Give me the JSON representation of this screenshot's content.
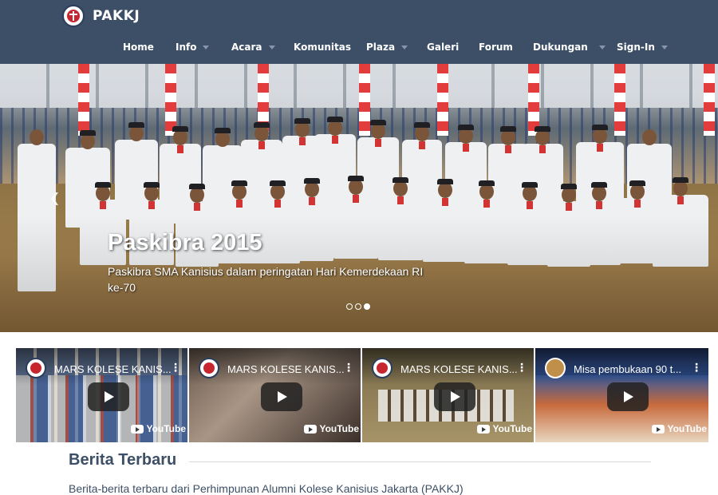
{
  "brand": {
    "name": "PAKKJ"
  },
  "nav": [
    {
      "label": "Home",
      "dropdown": false
    },
    {
      "label": "Info",
      "dropdown": true
    },
    {
      "label": "Acara",
      "dropdown": true
    },
    {
      "label": "Komunitas",
      "dropdown": false
    },
    {
      "label": "Plaza",
      "dropdown": true
    },
    {
      "label": "Galeri",
      "dropdown": false
    },
    {
      "label": "Forum",
      "dropdown": false
    },
    {
      "label": "Dukungan",
      "dropdown": true
    },
    {
      "label": "Sign-In",
      "dropdown": true
    }
  ],
  "hero": {
    "title": "Paskibra 2015",
    "caption": "Paskibra SMA Kanisius dalam peringatan Hari Kemerdekaan RI ke-70",
    "prev_icon": "chevron-left-icon",
    "slides": 3,
    "active_slide": 3
  },
  "videos": [
    {
      "title": "MARS KOLESE KANIS...",
      "brand": "YouTube"
    },
    {
      "title": "MARS KOLESE KANIS...",
      "brand": "YouTube"
    },
    {
      "title": "MARS KOLESE KANIS...",
      "brand": "YouTube"
    },
    {
      "title": "Misa pembukaan 90 t...",
      "brand": "YouTube"
    }
  ],
  "news": {
    "title": "Berita Terbaru",
    "subtitle": "Berita-berita terbaru dari Perhimpunan Alumni Kolese Kanisius Jakarta (PAKKJ)"
  },
  "colors": {
    "header_bg": "#3c4f66",
    "accent_red": "#c8262e",
    "nav_caret": "#8596ad"
  }
}
